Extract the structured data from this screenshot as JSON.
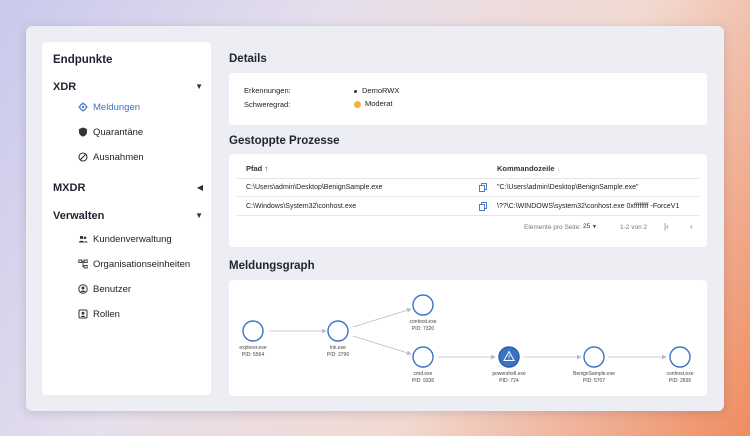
{
  "sidebar": {
    "title": "Endpunkte",
    "sections": [
      {
        "label": "XDR",
        "caret": "▼"
      },
      {
        "label": "MXDR",
        "caret": "◀"
      },
      {
        "label": "Verwalten",
        "caret": "▼"
      }
    ],
    "items": [
      {
        "label": "Meldungen",
        "icon": "gear-icon",
        "active": true
      },
      {
        "label": "Quarantäne",
        "icon": "shield-icon"
      },
      {
        "label": "Ausnahmen",
        "icon": "block-icon"
      },
      {
        "label": "Kundenverwaltung",
        "icon": "users-icon"
      },
      {
        "label": "Organisationseinheiten",
        "icon": "org-icon"
      },
      {
        "label": "Benutzer",
        "icon": "user-circle-icon"
      },
      {
        "label": "Rollen",
        "icon": "id-card-icon"
      }
    ]
  },
  "details": {
    "heading": "Details",
    "detection_label": "Erkennungen:",
    "detection_value": "DemoRWX",
    "severity_label": "Schweregrad:",
    "severity_value": "Moderat",
    "severity_color": "#f4b13e"
  },
  "processes": {
    "heading": "Gestoppte Prozesse",
    "columns": {
      "path": "Pfad",
      "path_sort": "↑",
      "cmd": "Kommandozeile",
      "cmd_sort": "↓"
    },
    "rows": [
      {
        "path": "C:\\Users\\admin\\Desktop\\BenignSample.exe",
        "cmd": "\"C:\\Users\\admin\\Desktop\\BenignSample.exe\""
      },
      {
        "path": "C:\\Windows\\System32\\conhost.exe",
        "cmd": "\\??\\C:\\WINDOWS\\system32\\conhost.exe 0xffffffff -ForceV1"
      }
    ],
    "pager": {
      "per_page_label": "Elemente pro Seite:",
      "per_page": "25",
      "range": "1-2 von 2"
    }
  },
  "graph": {
    "heading": "Meldungsgraph",
    "nodes": [
      {
        "name": "explorer.exe",
        "pid": "PID: 5564"
      },
      {
        "name": "lnk.exe",
        "pid": "PID: 3796"
      },
      {
        "name": "conhost.exe",
        "pid": "PID: 7320"
      },
      {
        "name": "cmd.exe",
        "pid": "PID: 9336"
      },
      {
        "name": "powershell.exe",
        "pid": "PID: 724"
      },
      {
        "name": "BenignSample.exe",
        "pid": "PID: 5707"
      },
      {
        "name": "conhost.exe",
        "pid": "PID: 2836"
      }
    ],
    "alert_color": "#3b73c4"
  }
}
